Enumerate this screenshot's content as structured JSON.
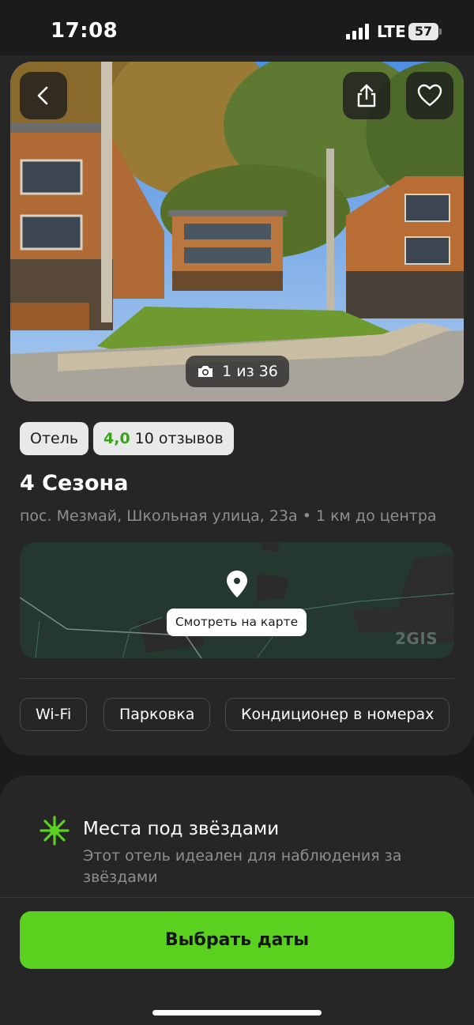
{
  "status": {
    "time": "17:08",
    "network": "LTE",
    "battery": "57"
  },
  "hero": {
    "photo_counter": "1 из 36"
  },
  "chips": {
    "type": "Отель",
    "rating": "4,0",
    "reviews": "10 отзывов"
  },
  "hotel": {
    "name": "4 Сезона",
    "address": "пос. Мезмай, Школьная улица, 23а • 1 км до центра"
  },
  "map": {
    "button_label": "Смотреть на карте",
    "brand": "2GIS"
  },
  "amenities": [
    "Wi-Fi",
    "Парковка",
    "Кондиционер в номерах"
  ],
  "feature": {
    "title": "Места под звёздами",
    "description": "Этот отель идеален для наблюдения за звёздами"
  },
  "cta": {
    "label": "Выбрать даты"
  },
  "colors": {
    "accent": "#5ad11e",
    "rating": "#3aa31e",
    "background": "#1b1b1b",
    "card": "#262626"
  }
}
